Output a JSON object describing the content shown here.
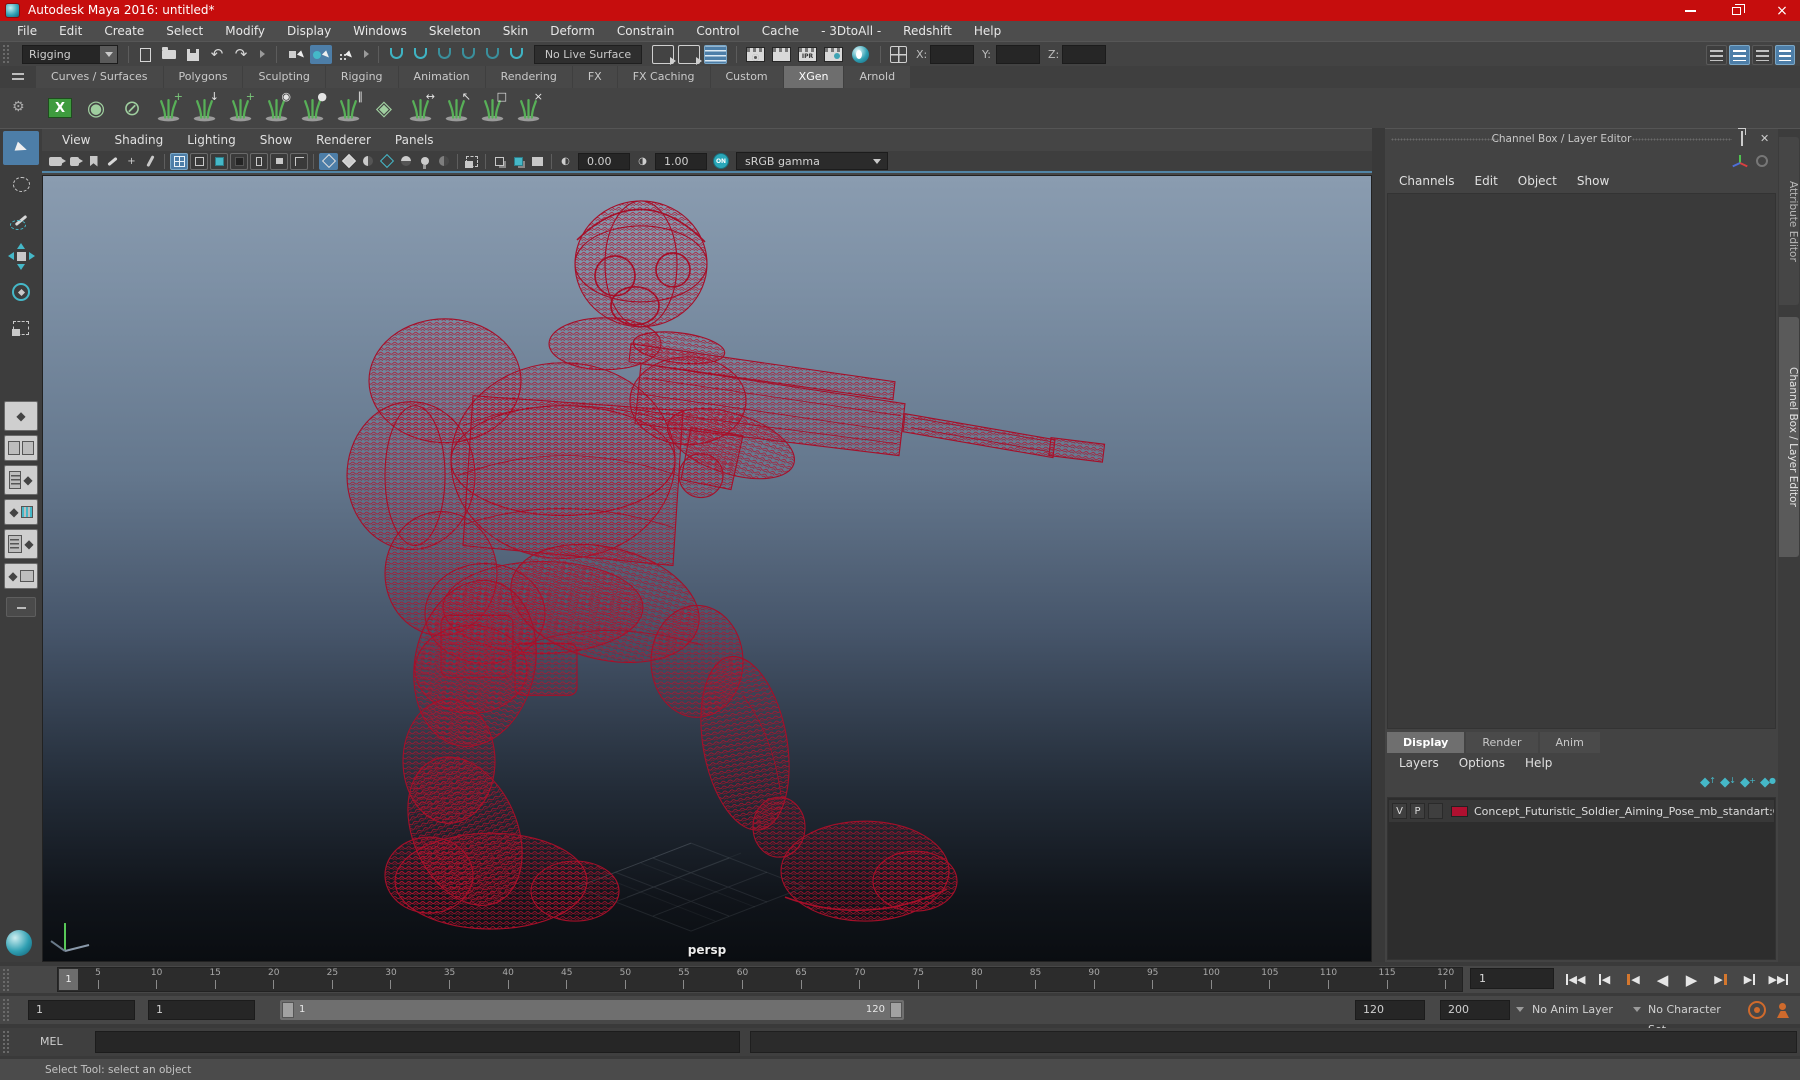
{
  "window": {
    "title": "Autodesk Maya 2016: untitled*"
  },
  "menu_bar": {
    "items": [
      "File",
      "Edit",
      "Create",
      "Select",
      "Modify",
      "Display",
      "Windows",
      "Skeleton",
      "Skin",
      "Deform",
      "Constrain",
      "Control",
      "Cache",
      "- 3DtoAll -",
      "Redshift",
      "Help"
    ]
  },
  "status_line": {
    "menu_set": "Rigging",
    "no_live_surface": "No Live Surface",
    "ipr_label": "IPR",
    "coord_labels": {
      "x": "X:",
      "y": "Y:",
      "z": "Z:"
    },
    "accent_blue": "#4d7ea8",
    "accent_teal": "#45b8c8"
  },
  "shelf": {
    "tabs": [
      {
        "label": "Curves / Surfaces"
      },
      {
        "label": "Polygons"
      },
      {
        "label": "Sculpting"
      },
      {
        "label": "Rigging"
      },
      {
        "label": "Animation"
      },
      {
        "label": "Rendering"
      },
      {
        "label": "FX"
      },
      {
        "label": "FX Caching"
      },
      {
        "label": "Custom"
      },
      {
        "label": "XGen",
        "active": true
      },
      {
        "label": "Arnold"
      }
    ],
    "icons": [
      {
        "name": "xgen-editor-icon",
        "kind": "panel",
        "badge": "X"
      },
      {
        "name": "xgen-update-preview-icon",
        "kind": "solo",
        "badge": "◉"
      },
      {
        "name": "xgen-disable-preview-icon",
        "kind": "solo",
        "badge": "⊘"
      },
      {
        "name": "xgen-create-description-icon",
        "kind": "green",
        "badge": "+"
      },
      {
        "name": "xgen-export-archive-icon",
        "badge": "↓"
      },
      {
        "name": "xgen-add-guide-icon",
        "kind": "green",
        "badge": "+"
      },
      {
        "name": "xgen-guide-visibility-icon",
        "badge": "◉"
      },
      {
        "name": "xgen-lock-guides-icon",
        "badge": "●"
      },
      {
        "name": "xgen-comb-guides-icon",
        "badge": "∥"
      },
      {
        "name": "xgen-description-layers-icon",
        "kind": "solo",
        "badge": "◈"
      },
      {
        "name": "xgen-guide-width-icon",
        "badge": "↔"
      },
      {
        "name": "xgen-select-guides-icon",
        "badge": "↖"
      },
      {
        "name": "xgen-convert-region-icon",
        "badge": "□"
      },
      {
        "name": "xgen-move-guides-icon",
        "badge": "×"
      }
    ]
  },
  "panel_menu": {
    "items": [
      "View",
      "Shading",
      "Lighting",
      "Show",
      "Renderer",
      "Panels"
    ]
  },
  "viewport": {
    "exposure": "0.00",
    "gamma": "1.00",
    "on_label": "ON",
    "view_transform": "sRGB gamma",
    "camera_label": "persp",
    "wireframe_color": "#a50f29"
  },
  "channel_box": {
    "title": "Channel Box / Layer Editor",
    "menus": [
      "Channels",
      "Edit",
      "Object",
      "Show"
    ]
  },
  "layer_editor": {
    "tabs": [
      {
        "label": "Display",
        "active": true
      },
      {
        "label": "Render"
      },
      {
        "label": "Anim"
      }
    ],
    "menus": [
      "Layers",
      "Options",
      "Help"
    ],
    "layer": {
      "visibility": "V",
      "playback": "P",
      "color": "#b01030",
      "name": "Concept_Futuristic_Soldier_Aiming_Pose_mb_standart:Co"
    }
  },
  "side_tabs": {
    "items": [
      {
        "label": "Attribute Editor"
      },
      {
        "label": "Channel Box / Layer Editor",
        "active": true
      }
    ]
  },
  "time_slider": {
    "current_frame": "1",
    "current_time": "1",
    "ticks": [
      5,
      10,
      15,
      20,
      25,
      30,
      35,
      40,
      45,
      50,
      55,
      60,
      65,
      70,
      75,
      80,
      85,
      90,
      95,
      100,
      105,
      110,
      115,
      120
    ]
  },
  "range_slider": {
    "anim_start": "1",
    "playback_start": "1",
    "bar_start_label": "1",
    "bar_end_label": "120",
    "playback_end": "120",
    "anim_end": "200",
    "anim_layer": "No Anim Layer",
    "character_set": "No Character Set"
  },
  "command_line": {
    "label": "MEL"
  },
  "help_line": {
    "message": "Select Tool: select an object"
  }
}
